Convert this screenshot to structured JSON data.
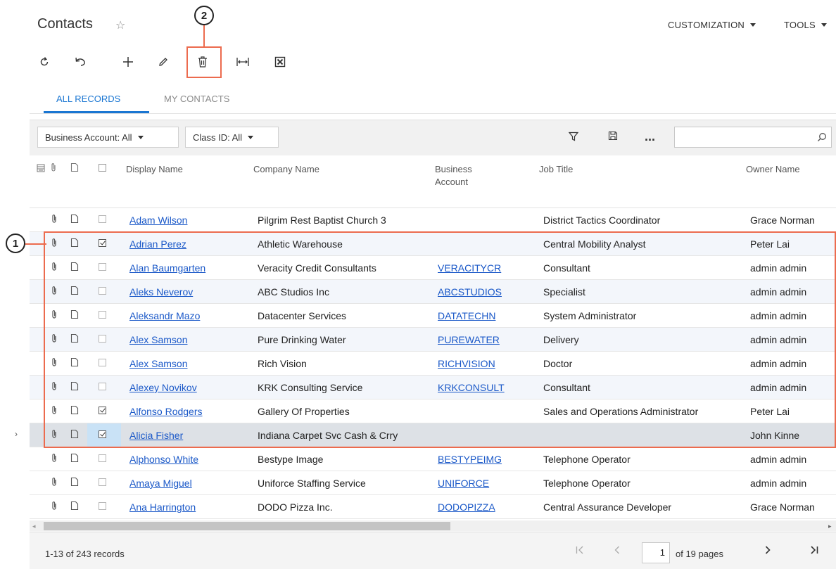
{
  "header": {
    "title": "Contacts",
    "star_icon": "star-outline-icon",
    "menus": [
      {
        "label": "CUSTOMIZATION"
      },
      {
        "label": "TOOLS"
      }
    ]
  },
  "toolbar": {
    "buttons": [
      "refresh-icon",
      "undo-icon",
      "add-icon",
      "edit-icon",
      "delete-icon",
      "fit-columns-icon",
      "excel-export-icon"
    ]
  },
  "callouts": {
    "one": "1",
    "two": "2"
  },
  "tabs": [
    {
      "label": "ALL RECORDS",
      "active": true
    },
    {
      "label": "MY CONTACTS",
      "active": false
    }
  ],
  "filters": {
    "business_account": "Business Account: All",
    "class_id": "Class ID: All",
    "more": "...",
    "search_value": ""
  },
  "grid": {
    "columns": {
      "display_name": "Display Name",
      "company_name": "Company Name",
      "business_account_1": "Business",
      "business_account_2": "Account",
      "job_title": "Job Title",
      "owner_name": "Owner Name"
    },
    "rows": [
      {
        "display": "Adam Wilson",
        "company": "Pilgrim Rest Baptist Church 3",
        "account": "",
        "job": "District Tactics Coordinator",
        "owner": "Grace Norman",
        "checked": false
      },
      {
        "display": "Adrian Perez",
        "company": "Athletic Warehouse",
        "account": "",
        "job": "Central Mobility Analyst",
        "owner": "Peter Lai",
        "checked": true
      },
      {
        "display": "Alan Baumgarten",
        "company": "Veracity Credit Consultants",
        "account": "VERACITYCR",
        "job": "Consultant",
        "owner": "admin admin",
        "checked": false
      },
      {
        "display": "Aleks Neverov",
        "company": "ABC Studios Inc",
        "account": "ABCSTUDIOS",
        "job": "Specialist",
        "owner": "admin admin",
        "checked": false
      },
      {
        "display": "Aleksandr Mazo",
        "company": "Datacenter Services",
        "account": "DATATECHN",
        "job": "System Administrator",
        "owner": "admin admin",
        "checked": false
      },
      {
        "display": "Alex Samson",
        "company": "Pure Drinking Water",
        "account": "PUREWATER",
        "job": "Delivery",
        "owner": "admin admin",
        "checked": false
      },
      {
        "display": "Alex Samson",
        "company": "Rich Vision",
        "account": "RICHVISION",
        "job": "Doctor",
        "owner": "admin admin",
        "checked": false
      },
      {
        "display": "Alexey Novikov",
        "company": "KRK Consulting Service",
        "account": "KRKCONSULT",
        "job": "Consultant",
        "owner": "admin admin",
        "checked": false
      },
      {
        "display": "Alfonso Rodgers",
        "company": "Gallery Of Properties",
        "account": "",
        "job": "Sales and Operations Administrator",
        "owner": "Peter Lai",
        "checked": true
      },
      {
        "display": "Alicia Fisher",
        "company": "Indiana Carpet Svc Cash & Crry",
        "account": "",
        "job": "",
        "owner": "John Kinne",
        "checked": true
      },
      {
        "display": "Alphonso White",
        "company": "Bestype Image",
        "account": "BESTYPEIMG",
        "job": "Telephone Operator",
        "owner": "admin admin",
        "checked": false
      },
      {
        "display": "Amaya Miguel",
        "company": "Uniforce Staffing Service",
        "account": "UNIFORCE",
        "job": "Telephone Operator",
        "owner": "admin admin",
        "checked": false
      },
      {
        "display": "Ana Harrington",
        "company": "DODO Pizza Inc.",
        "account": "DODOPIZZA",
        "job": "Central Assurance Developer",
        "owner": "Grace Norman",
        "checked": false
      }
    ]
  },
  "footer": {
    "records": "1-13 of 243 records",
    "page": "1",
    "pages": "of 19 pages"
  },
  "colors": {
    "accent": "#1a76d2",
    "link": "#1a58c8",
    "callout_red": "#ec6b4e"
  }
}
